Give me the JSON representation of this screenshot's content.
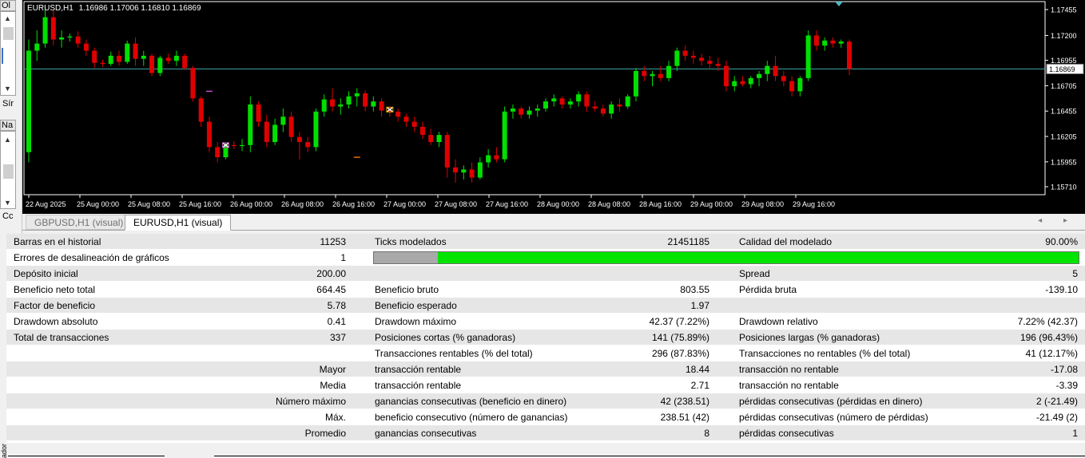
{
  "left_panel": {
    "top_header": "Ol",
    "mid_header": "Na",
    "partial_label_1": "Sír",
    "partial_label_2": "Cc",
    "partial_label_3": "ador"
  },
  "chart": {
    "symbol_timeframe": "EURUSD,H1",
    "ohlc": "1.16986 1.17006 1.16810 1.16869",
    "current_price_label": "1.16869",
    "y_ticks": [
      "1.17455",
      "1.17200",
      "1.16955",
      "1.16705",
      "1.16455",
      "1.16205",
      "1.15955",
      "1.15710"
    ],
    "x_ticks": [
      "22 Aug 2025",
      "25 Aug 00:00",
      "25 Aug 08:00",
      "25 Aug 16:00",
      "26 Aug 00:00",
      "26 Aug 08:00",
      "26 Aug 16:00",
      "27 Aug 00:00",
      "27 Aug 08:00",
      "27 Aug 16:00",
      "28 Aug 00:00",
      "28 Aug 08:00",
      "28 Aug 16:00",
      "29 Aug 00:00",
      "29 Aug 08:00",
      "29 Aug 16:00"
    ],
    "colors": {
      "background": "#000000",
      "bull": "#00e000",
      "bear": "#e00000",
      "price_line": "#3fa7a7",
      "axis": "#ffffff",
      "marker": "#4fb6c4"
    },
    "candles": [
      [
        1.1605,
        1.1716,
        1.1595,
        1.1705
      ],
      [
        1.1705,
        1.1725,
        1.1695,
        1.1712
      ],
      [
        1.1712,
        1.1748,
        1.1708,
        1.1738
      ],
      [
        1.1738,
        1.1745,
        1.171,
        1.1716
      ],
      [
        1.1716,
        1.1725,
        1.1708,
        1.1718
      ],
      [
        1.1718,
        1.1722,
        1.1714,
        1.1719
      ],
      [
        1.1719,
        1.1724,
        1.1708,
        1.1712
      ],
      [
        1.1712,
        1.1716,
        1.17,
        1.1705
      ],
      [
        1.1705,
        1.1708,
        1.1688,
        1.1693
      ],
      [
        1.1693,
        1.1696,
        1.1689,
        1.1692
      ],
      [
        1.1692,
        1.1704,
        1.169,
        1.17
      ],
      [
        1.17,
        1.1705,
        1.169,
        1.1694
      ],
      [
        1.1694,
        1.1715,
        1.1692,
        1.1712
      ],
      [
        1.1712,
        1.1718,
        1.169,
        1.1697
      ],
      [
        1.1697,
        1.1705,
        1.169,
        1.17
      ],
      [
        1.17,
        1.1702,
        1.168,
        1.1683
      ],
      [
        1.1683,
        1.17,
        1.168,
        1.1698
      ],
      [
        1.1698,
        1.1702,
        1.1692,
        1.1695
      ],
      [
        1.1695,
        1.1705,
        1.169,
        1.17
      ],
      [
        1.17,
        1.1702,
        1.1686,
        1.1688
      ],
      [
        1.1688,
        1.169,
        1.1655,
        1.1658
      ],
      [
        1.1658,
        1.166,
        1.163,
        1.1635
      ],
      [
        1.1635,
        1.164,
        1.1605,
        1.161
      ],
      [
        1.161,
        1.1615,
        1.1595,
        1.16
      ],
      [
        1.16,
        1.1614,
        1.1598,
        1.1612
      ],
      [
        1.1612,
        1.1616,
        1.1608,
        1.1611
      ],
      [
        1.1611,
        1.1618,
        1.1606,
        1.1612
      ],
      [
        1.1612,
        1.166,
        1.1605,
        1.1652
      ],
      [
        1.1652,
        1.1655,
        1.163,
        1.1635
      ],
      [
        1.1635,
        1.1642,
        1.161,
        1.1615
      ],
      [
        1.1615,
        1.1638,
        1.1612,
        1.1632
      ],
      [
        1.1632,
        1.1648,
        1.1625,
        1.164
      ],
      [
        1.164,
        1.1645,
        1.1615,
        1.162
      ],
      [
        1.162,
        1.1625,
        1.1598,
        1.1615
      ],
      [
        1.1615,
        1.162,
        1.1605,
        1.161
      ],
      [
        1.161,
        1.1648,
        1.1606,
        1.1645
      ],
      [
        1.1645,
        1.1662,
        1.164,
        1.1657
      ],
      [
        1.1657,
        1.1668,
        1.1645,
        1.165
      ],
      [
        1.165,
        1.1658,
        1.1642,
        1.1652
      ],
      [
        1.1652,
        1.1665,
        1.1648,
        1.166
      ],
      [
        1.166,
        1.1668,
        1.165,
        1.1663
      ],
      [
        1.1663,
        1.1666,
        1.1645,
        1.165
      ],
      [
        1.165,
        1.166,
        1.1645,
        1.1655
      ],
      [
        1.1655,
        1.1658,
        1.164,
        1.1646
      ],
      [
        1.1646,
        1.165,
        1.164,
        1.1645
      ],
      [
        1.1645,
        1.1648,
        1.1635,
        1.164
      ],
      [
        1.164,
        1.1643,
        1.163,
        1.1635
      ],
      [
        1.1635,
        1.164,
        1.1625,
        1.163
      ],
      [
        1.163,
        1.1635,
        1.1618,
        1.1622
      ],
      [
        1.1622,
        1.1628,
        1.1612,
        1.1615
      ],
      [
        1.1615,
        1.1625,
        1.161,
        1.1622
      ],
      [
        1.1622,
        1.1625,
        1.158,
        1.159
      ],
      [
        1.159,
        1.1598,
        1.1575,
        1.1585
      ],
      [
        1.1585,
        1.1592,
        1.1578,
        1.1588
      ],
      [
        1.1588,
        1.1595,
        1.1575,
        1.158
      ],
      [
        1.158,
        1.16,
        1.1578,
        1.1595
      ],
      [
        1.1595,
        1.1608,
        1.159,
        1.1602
      ],
      [
        1.1602,
        1.161,
        1.1595,
        1.1598
      ],
      [
        1.1598,
        1.165,
        1.1595,
        1.1645
      ],
      [
        1.1645,
        1.1652,
        1.1638,
        1.1648
      ],
      [
        1.1648,
        1.165,
        1.1638,
        1.1642
      ],
      [
        1.1642,
        1.165,
        1.1638,
        1.1646
      ],
      [
        1.1646,
        1.1652,
        1.164,
        1.1648
      ],
      [
        1.1648,
        1.1658,
        1.1645,
        1.1655
      ],
      [
        1.1655,
        1.1662,
        1.165,
        1.1658
      ],
      [
        1.1658,
        1.166,
        1.1648,
        1.1652
      ],
      [
        1.1652,
        1.1658,
        1.1648,
        1.1655
      ],
      [
        1.1655,
        1.1665,
        1.165,
        1.1662
      ],
      [
        1.1662,
        1.1665,
        1.1645,
        1.165
      ],
      [
        1.165,
        1.1655,
        1.1645,
        1.1648
      ],
      [
        1.1648,
        1.1652,
        1.164,
        1.1643
      ],
      [
        1.1643,
        1.1655,
        1.1638,
        1.1652
      ],
      [
        1.1652,
        1.1658,
        1.1645,
        1.165
      ],
      [
        1.165,
        1.1662,
        1.1648,
        1.166
      ],
      [
        1.166,
        1.1688,
        1.1655,
        1.1685
      ],
      [
        1.1685,
        1.169,
        1.1675,
        1.168
      ],
      [
        1.168,
        1.1685,
        1.167,
        1.1682
      ],
      [
        1.1682,
        1.169,
        1.1675,
        1.1678
      ],
      [
        1.1678,
        1.1695,
        1.1675,
        1.169
      ],
      [
        1.169,
        1.1708,
        1.1685,
        1.1705
      ],
      [
        1.1705,
        1.171,
        1.1695,
        1.17
      ],
      [
        1.17,
        1.1705,
        1.1692,
        1.1698
      ],
      [
        1.1698,
        1.1702,
        1.169,
        1.1695
      ],
      [
        1.1695,
        1.17,
        1.1688,
        1.1692
      ],
      [
        1.1692,
        1.1698,
        1.1685,
        1.169
      ],
      [
        1.169,
        1.1695,
        1.1665,
        1.167
      ],
      [
        1.167,
        1.168,
        1.1665,
        1.1675
      ],
      [
        1.1675,
        1.168,
        1.167,
        1.1672
      ],
      [
        1.1672,
        1.168,
        1.1668,
        1.1678
      ],
      [
        1.1678,
        1.1685,
        1.167,
        1.1682
      ],
      [
        1.1682,
        1.1695,
        1.1675,
        1.169
      ],
      [
        1.169,
        1.17,
        1.1675,
        1.168
      ],
      [
        1.168,
        1.1685,
        1.167,
        1.1675
      ],
      [
        1.1675,
        1.168,
        1.166,
        1.1665
      ],
      [
        1.1665,
        1.168,
        1.166,
        1.1678
      ],
      [
        1.1678,
        1.1725,
        1.1675,
        1.172
      ],
      [
        1.172,
        1.1725,
        1.1705,
        1.171
      ],
      [
        1.171,
        1.1718,
        1.1705,
        1.1715
      ],
      [
        1.1715,
        1.1718,
        1.1708,
        1.1712
      ],
      [
        1.1712,
        1.1716,
        1.1708,
        1.1714
      ],
      [
        1.1714,
        1.1716,
        1.1681,
        1.1687
      ]
    ],
    "markers": [
      {
        "type": "close-cross",
        "index": 24,
        "price": 1.1612
      },
      {
        "type": "close-cross",
        "index": 44,
        "price": 1.1647
      },
      {
        "type": "pending-order",
        "index": 22,
        "price": 1.1665
      },
      {
        "type": "pending-order",
        "index": 40,
        "price": 1.16
      }
    ]
  },
  "tabs": [
    {
      "label": "GBPUSD,H1 (visual)",
      "active": false
    },
    {
      "label": "EURUSD,H1 (visual)",
      "active": true
    }
  ],
  "tab_nav": "◂ ▸",
  "report": {
    "quality_value": 0.0909,
    "rows": [
      {
        "l1": "Barras en el historial",
        "v1": "11253",
        "l2": "Ticks modelados",
        "v2": "21451185",
        "l3": "Calidad del modelado",
        "v3": "90.00%"
      },
      {
        "l1": "Errores de desalineación de gráficos",
        "v1": "1",
        "l2": "",
        "v2": "",
        "l3": "",
        "v3": ""
      },
      {
        "l1": "Depósito inicial",
        "v1": "200.00",
        "l2": "",
        "v2": "",
        "l3": "Spread",
        "v3": "5"
      },
      {
        "l1": "Beneficio neto total",
        "v1": "664.45",
        "l2": "Beneficio bruto",
        "v2": "803.55",
        "l3": "Pérdida bruta",
        "v3": "-139.10"
      },
      {
        "l1": "Factor de beneficio",
        "v1": "5.78",
        "l2": "Beneficio esperado",
        "v2": "1.97",
        "l3": "",
        "v3": ""
      },
      {
        "l1": "Drawdown absoluto",
        "v1": "0.41",
        "l2": "Drawdown máximo",
        "v2": "42.37 (7.22%)",
        "l3": "Drawdown relativo",
        "v3": "7.22% (42.37)"
      },
      {
        "l1": "Total de transacciones",
        "v1": "337",
        "l2": "Posiciones cortas (% ganadoras)",
        "v2": "141 (75.89%)",
        "l3": "Posiciones largas (% ganadoras)",
        "v3": "196 (96.43%)"
      },
      {
        "l1": "",
        "v1": "",
        "l2": "Transacciones rentables (% del total)",
        "v2": "296 (87.83%)",
        "l3": "Transacciones no rentables (% del total)",
        "v3": "41 (12.17%)"
      },
      {
        "l1": "",
        "v1": "Mayor",
        "l2": "transacción rentable",
        "v2": "18.44",
        "l3": "transacción no rentable",
        "v3": "-17.08"
      },
      {
        "l1": "",
        "v1": "Media",
        "l2": "transacción rentable",
        "v2": "2.71",
        "l3": "transacción no rentable",
        "v3": "-3.39"
      },
      {
        "l1": "",
        "v1": "Número máximo",
        "l2": "ganancias consecutivas (beneficio en dinero)",
        "v2": "42 (238.51)",
        "l3": "pérdidas consecutivas (pérdidas en dinero)",
        "v3": "2 (-21.49)"
      },
      {
        "l1": "",
        "v1": "Máx.",
        "l2": "beneficio consecutivo (número de ganancias)",
        "v2": "238.51 (42)",
        "l3": "pérdidas consecutivas (número de pérdidas)",
        "v3": "-21.49 (2)"
      },
      {
        "l1": "",
        "v1": "Promedio",
        "l2": "ganancias consecutivas",
        "v2": "8",
        "l3": "pérdidas consecutivas",
        "v3": "1"
      }
    ]
  }
}
